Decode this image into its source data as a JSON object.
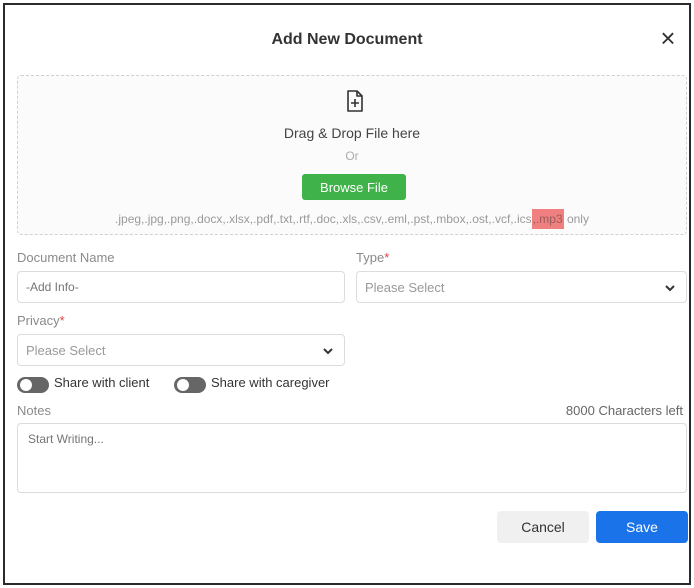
{
  "dialog": {
    "title": "Add New Document",
    "close_symbol": "×"
  },
  "upload": {
    "icon": "file-add-icon",
    "drag_text": "Drag & Drop File here",
    "or_text": "Or",
    "browse_label": "Browse File",
    "formats_prefix": ".jpeg,.jpg,.png,.docx,.xlsx,.pdf,.txt,.rtf,.doc,.xls,.csv,.eml,.pst,.mbox,.ost,.vcf,.ics",
    "formats_highlight": ",.mp3",
    "formats_suffix": " only",
    "button_color": "#3fb24a",
    "highlight_color": "#f08080"
  },
  "form": {
    "document_name": {
      "label": "Document Name",
      "placeholder": "-Add Info-"
    },
    "type": {
      "label": "Type",
      "required_mark": "*",
      "value": "Please Select"
    },
    "privacy": {
      "label": "Privacy",
      "required_mark": "*",
      "value": "Please Select"
    },
    "toggles": [
      {
        "label": "Share with client",
        "on": false
      },
      {
        "label": "Share with caregiver",
        "on": false
      }
    ],
    "notes": {
      "label": "Notes",
      "counter": "8000 Characters left",
      "placeholder": "Start Writing..."
    }
  },
  "actions": {
    "cancel_label": "Cancel",
    "save_label": "Save",
    "save_color": "#1a73e8"
  }
}
